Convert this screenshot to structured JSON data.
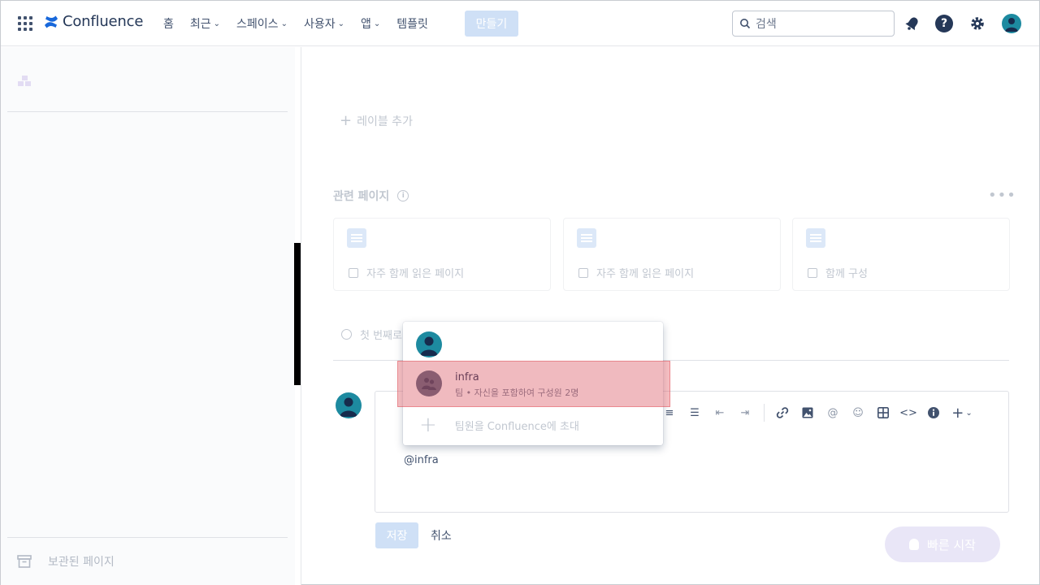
{
  "topnav": {
    "logo_text": "Confluence",
    "items": [
      {
        "label": "홈",
        "chevron": false
      },
      {
        "label": "최근",
        "chevron": true
      },
      {
        "label": "스페이스",
        "chevron": true
      },
      {
        "label": "사용자",
        "chevron": true
      },
      {
        "label": "앱",
        "chevron": true
      },
      {
        "label": "템플릿",
        "chevron": false
      }
    ],
    "create_label": "만들기",
    "search_placeholder": "검색",
    "brand_color": "#0052cc"
  },
  "sidebar": {
    "archived_label": "보관된 페이지"
  },
  "main": {
    "add_label": "레이블 추가",
    "related_title": "관련 페이지",
    "cards": [
      {
        "caption": "자주 함께 읽은 페이지"
      },
      {
        "caption": "자주 함께 읽은 페이지"
      },
      {
        "caption": "함께 구성"
      }
    ],
    "first_reply": "첫 번째로"
  },
  "editor": {
    "mention_text": "@infra",
    "save_label": "저장",
    "cancel_label": "취소"
  },
  "dropdown": {
    "team_name": "infra",
    "team_sub": "팀 • 자신을 포함하여 구성원 2명",
    "invite_label": "팀원을 Confluence에 초대"
  },
  "quick_start": {
    "label": "빠른 시작"
  }
}
